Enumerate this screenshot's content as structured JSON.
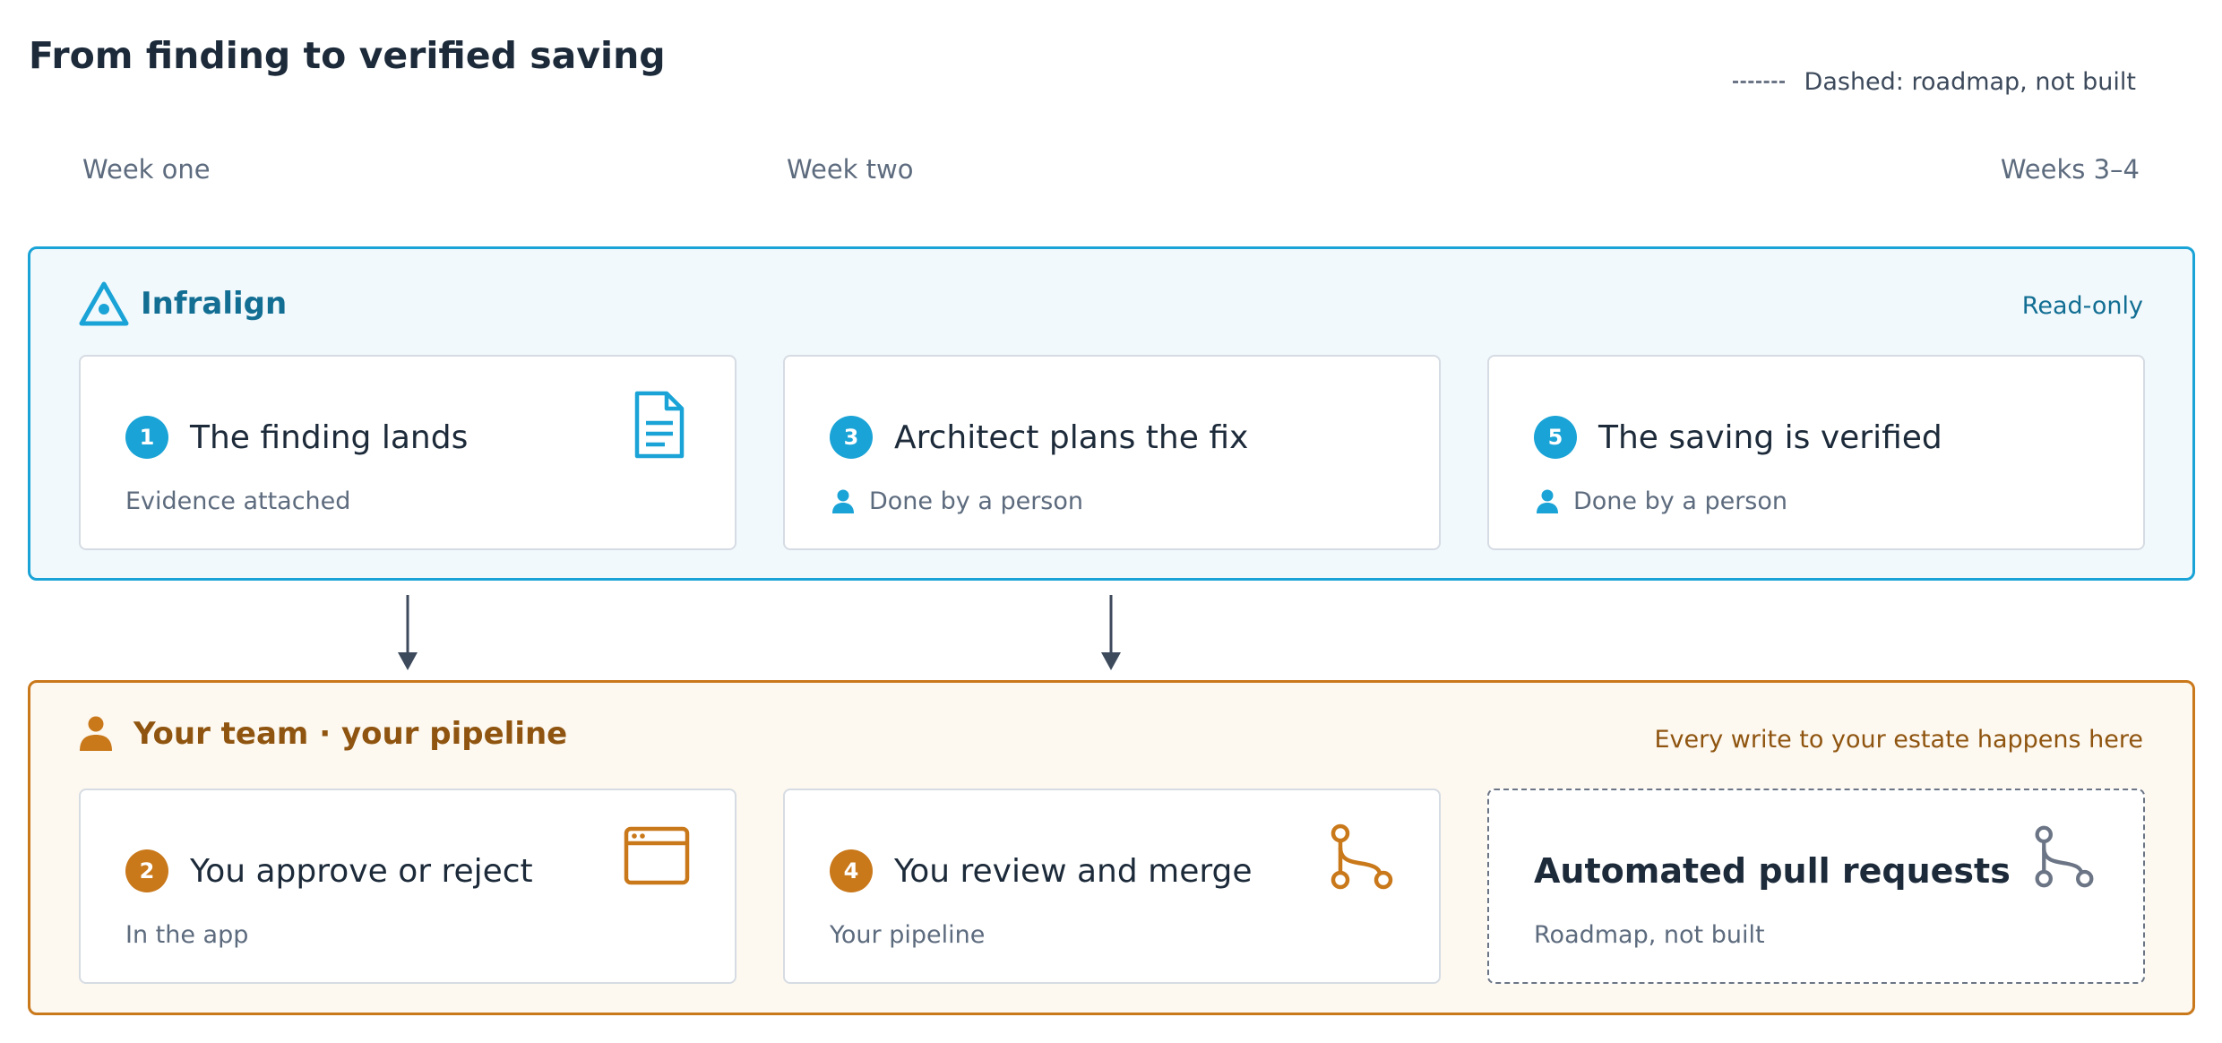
{
  "title": "From finding to verified saving",
  "legend": {
    "label": "Dashed: roadmap, not built"
  },
  "weeks": [
    "Week one",
    "Week two",
    "Weeks 3–4"
  ],
  "top_panel": {
    "brand": "Infralign",
    "note": "Read-only",
    "color": "#1aa3d6",
    "cards": [
      {
        "number": "1",
        "title": "The finding lands",
        "subtitle": "Evidence attached",
        "icon": "document-icon"
      },
      {
        "number": "3",
        "title": "Architect plans the fix",
        "subtitle": "Done by a person",
        "icon": "person-icon"
      },
      {
        "number": "5",
        "title": "The saving is verified",
        "subtitle": "Done by a person",
        "icon": "person-icon"
      }
    ]
  },
  "bottom_panel": {
    "heading": "Your team · your pipeline",
    "note": "Every write to your estate happens here",
    "color": "#c9781a",
    "cards": [
      {
        "number": "2",
        "title": "You approve or reject",
        "subtitle": "In the app",
        "icon": "browser-window-icon"
      },
      {
        "number": "4",
        "title": "You review and merge",
        "subtitle": "Your pipeline",
        "icon": "git-merge-icon"
      },
      {
        "number": "",
        "title": "Automated pull requests",
        "subtitle": "Roadmap, not built",
        "icon": "git-merge-icon",
        "roadmap": true
      }
    ]
  }
}
